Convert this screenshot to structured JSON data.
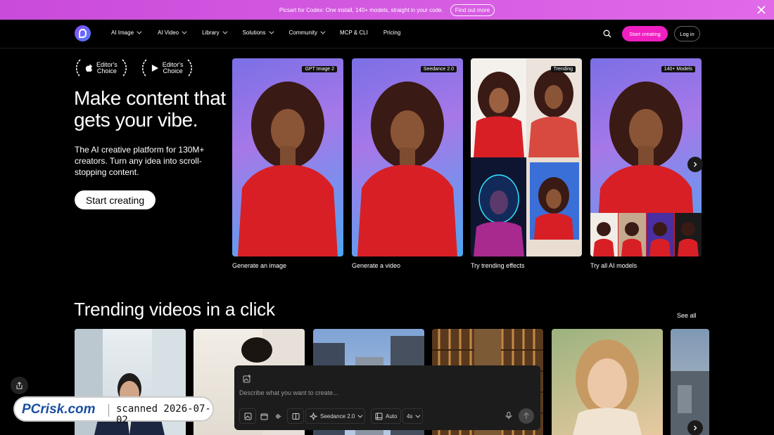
{
  "promo": {
    "text": "Picsart for Codex: One install, 140+ models, straight in your code.",
    "button": "Find out more"
  },
  "nav": {
    "items": [
      {
        "label": "AI Image",
        "dropdown": true
      },
      {
        "label": "AI Video",
        "dropdown": true
      },
      {
        "label": "Library",
        "dropdown": true
      },
      {
        "label": "Solutions",
        "dropdown": true
      },
      {
        "label": "Community",
        "dropdown": true
      },
      {
        "label": "MCP & CLI",
        "dropdown": false
      },
      {
        "label": "Pricing",
        "dropdown": false
      }
    ],
    "start_label": "Start creating",
    "login_label": "Log in"
  },
  "hero": {
    "awards": [
      {
        "platform": "apple-icon",
        "line1": "Editor's",
        "line2": "Choice"
      },
      {
        "platform": "google-play-icon",
        "line1": "Editor's",
        "line2": "Choice"
      }
    ],
    "title": "Make content that gets your vibe.",
    "subtitle": "The AI creative platform for 130M+ creators. Turn any idea into scroll-stopping content.",
    "cta": "Start creating"
  },
  "cards": [
    {
      "tag": "GPT Image 2",
      "label": "Generate an image"
    },
    {
      "tag": "Seedance 2.0",
      "label": "Generate a video"
    },
    {
      "tag": "Trending",
      "label": "Try trending effects"
    },
    {
      "tag": "140+ Models",
      "label": "Try all AI models"
    }
  ],
  "trending": {
    "title": "Trending videos in a click",
    "see_all": "See all"
  },
  "prompt": {
    "placeholder": "Describe what you want to create...",
    "model": "Seedance 2.0",
    "ratio": "Auto",
    "duration": "4s"
  },
  "watermark": {
    "logo": "PCrisk.com",
    "text": "scanned 2026-07-02"
  },
  "colors": {
    "accent": "#f01fc2",
    "promo": "#d257e0",
    "shirt": "#d81f26"
  }
}
